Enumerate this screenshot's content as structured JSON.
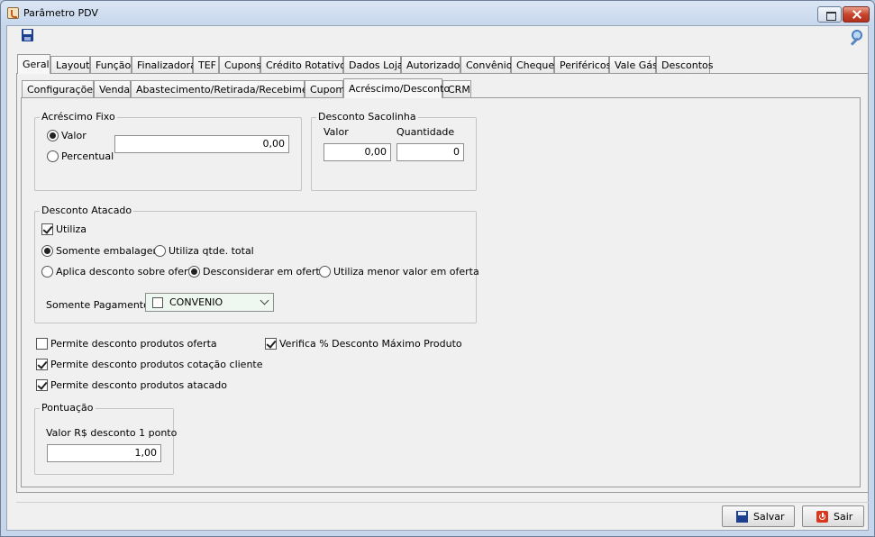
{
  "window": {
    "title": "Parâmetro PDV"
  },
  "main_tabs": [
    "Geral",
    "Layout",
    "Função",
    "Finalizadora",
    "TEF",
    "Cupons",
    "Crédito Rotativo",
    "Dados Loja",
    "Autorizador",
    "Convênio",
    "Cheque",
    "Periféricos",
    "Vale Gás",
    "Descontos"
  ],
  "main_tabs_active": "Geral",
  "sub_tabs": [
    "Configurações",
    "Venda",
    "Abastecimento/Retirada/Recebimento",
    "Cupom",
    "Acréscimo/Desconto",
    "CRM"
  ],
  "sub_tabs_active": "Acréscimo/Desconto",
  "acrescimo_fixo": {
    "title": "Acréscimo Fixo",
    "option_valor": "Valor",
    "option_percentual": "Percentual",
    "selected": "Valor",
    "value": "0,00"
  },
  "desconto_sacolinha": {
    "title": "Desconto Sacolinha",
    "valor_label": "Valor",
    "quantidade_label": "Quantidade",
    "valor": "0,00",
    "quantidade": "0"
  },
  "desconto_atacado": {
    "title": "Desconto Atacado",
    "utiliza_label": "Utiliza",
    "utiliza_checked": true,
    "somente_embalagem": "Somente embalagem",
    "utiliza_qtde_total": "Utiliza qtde. total",
    "aplica_desconto_sobre_oferta": "Aplica desconto sobre oferta",
    "desconsiderar_em_oferta": "Desconsiderar em oferta",
    "utiliza_menor_valor_em_oferta": "Utiliza menor valor em oferta",
    "somente_pagamento_label": "Somente Pagamento",
    "somente_pagamento_value": "CONVENIO"
  },
  "options": {
    "permite_oferta": "Permite desconto produtos oferta",
    "permite_oferta_checked": false,
    "permite_cotacao": "Permite desconto produtos cotação cliente",
    "permite_cotacao_checked": true,
    "permite_atacado": "Permite desconto produtos atacado",
    "permite_atacado_checked": true,
    "verifica_maximo": "Verifica % Desconto Máximo Produto",
    "verifica_maximo_checked": true
  },
  "pontuacao": {
    "title": "Pontuação",
    "valor_label": "Valor R$ desconto 1 ponto",
    "valor": "1,00"
  },
  "buttons": {
    "save": "Salvar",
    "exit": "Sair"
  }
}
